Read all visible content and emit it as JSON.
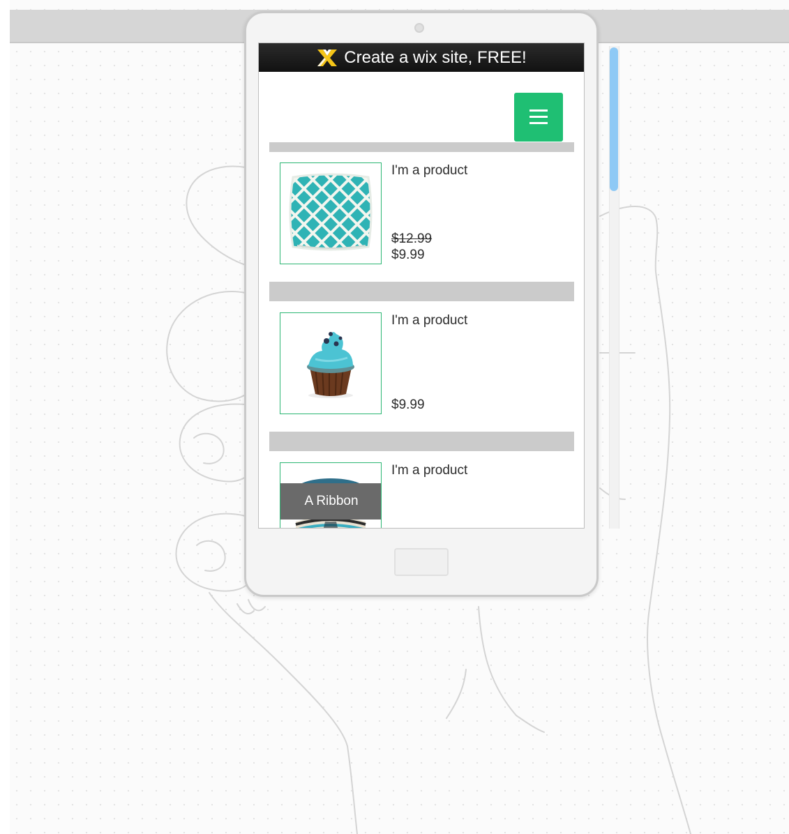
{
  "banner": {
    "text": "Create a wix site, FREE!",
    "logo": "wix-logo-icon"
  },
  "menu": {
    "icon": "hamburger-menu-icon",
    "color": "#1fbf73"
  },
  "accent_colors": {
    "thumb_border": "#2bb673",
    "scroll_thumb": "#8ec9f5",
    "separator": "#cbcbcb"
  },
  "products": [
    {
      "name": "I'm a product",
      "old_price": "$12.99",
      "price": "$9.99",
      "image": "teal-lattice-pillow"
    },
    {
      "name": "I'm a product",
      "price": "$9.99",
      "image": "blue-frosted-cupcake"
    },
    {
      "name": "I'm a product",
      "ribbon": "A Ribbon",
      "image": "striped-ribbon-spool"
    }
  ],
  "scrollbar": {
    "position_fraction": 0.0
  }
}
